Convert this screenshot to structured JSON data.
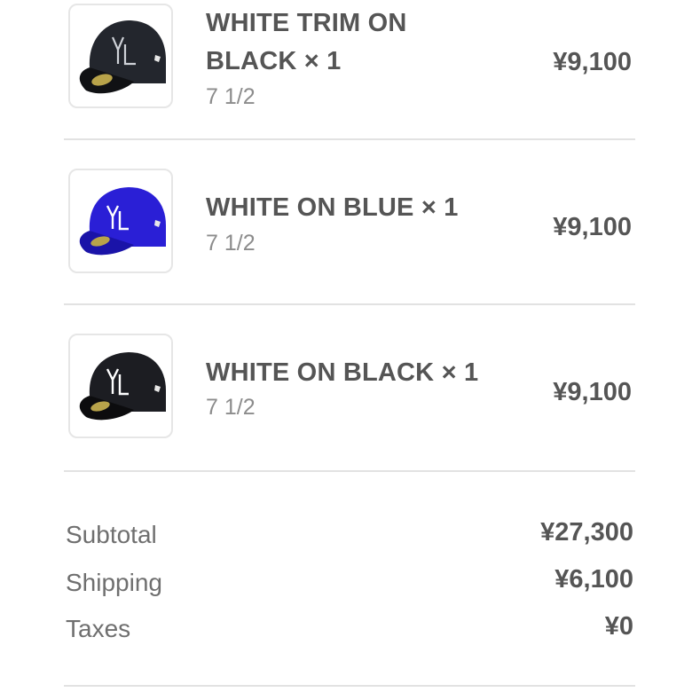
{
  "items": [
    {
      "title_line1": "WHITE TRIM ON",
      "title_line2": "BLACK × 1",
      "variant": "7 1/2",
      "price": "¥9,100",
      "image_icon": "black-cap-white-trim-icon",
      "cap_color": "#1e2127"
    },
    {
      "title_line1": "WHITE ON BLUE × 1",
      "variant": "7 1/2",
      "price": "¥9,100",
      "image_icon": "blue-cap-icon",
      "cap_color": "#2a1fd6"
    },
    {
      "title_line1": "WHITE ON BLACK × 1",
      "variant": "7 1/2",
      "price": "¥9,100",
      "image_icon": "black-cap-icon",
      "cap_color": "#1c1d22"
    }
  ],
  "summary": {
    "subtotal_label": "Subtotal",
    "subtotal_value": "¥27,300",
    "shipping_label": "Shipping",
    "shipping_value": "¥6,100",
    "taxes_label": "Taxes",
    "taxes_value": "¥0"
  }
}
